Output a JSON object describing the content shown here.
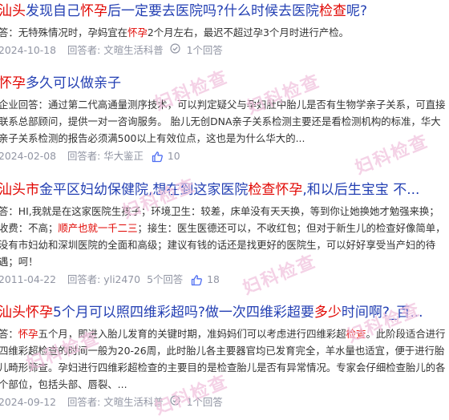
{
  "results": [
    {
      "title_parts": [
        {
          "text": "汕头",
          "hl": true
        },
        {
          "text": "发现自己",
          "hl": false
        },
        {
          "text": "怀孕",
          "hl": true
        },
        {
          "text": "后一定要去医院吗?什么时候去医院",
          "hl": false
        },
        {
          "text": "检查",
          "hl": true
        },
        {
          "text": "呢?",
          "hl": false
        }
      ],
      "snippet_parts": [
        {
          "text": "答：无特殊情况时，孕妈宜在",
          "hl": false
        },
        {
          "text": "怀孕",
          "hl": true
        },
        {
          "text": "2个月左右，最迟不超过孕3个月时进行产检。",
          "hl": false
        }
      ],
      "date": "2024-10-18",
      "answerer": "回答者: 文暄生活科普",
      "check_icon": true,
      "answers_count": "1个回答",
      "likes": ""
    },
    {
      "title_parts": [
        {
          "text": "怀孕",
          "hl": true
        },
        {
          "text": "多久可以做亲子",
          "hl": false
        }
      ],
      "snippet_parts": [
        {
          "text": "企业回答：通过第二代高通量测序技术，可以判定疑父与孕妇肚中胎儿是否有生物学亲子关系，可直接联系总部顾问，提供一对一咨询服务。 胎儿无创DNA亲子关系检测主要还是看检测机构的标准，华大亲子关系检测的报告必须满500以上有效位点，这也是为什么华大的...",
          "hl": false
        }
      ],
      "date": "2024-02-08",
      "answerer": "回答者: 华大鉴正",
      "check_icon": false,
      "answers_count": "",
      "likes": "10"
    },
    {
      "title_parts": [
        {
          "text": "汕头市",
          "hl": true
        },
        {
          "text": "金平区妇幼保健院,想在到这家医院",
          "hl": false
        },
        {
          "text": "检查怀孕",
          "hl": true
        },
        {
          "text": ",和以后生宝宝 不...",
          "hl": false
        }
      ],
      "snippet_parts": [
        {
          "text": "答：HI,我就是在这家医院生孩子；环境卫生：较差，床单没有天天换，等到你让她换她才勉强来换；收费：不高；",
          "hl": false
        },
        {
          "text": "顺产也就一千二三",
          "hl": true
        },
        {
          "text": "；接生：医生医德还可以，不收红包；但对于新生儿的检查好像简单，没有市妇幼和深圳医院的全面和高级；建议有钱的话还是找更好的医院生，可以好好享受当产妇的待遇；呵！",
          "hl": false
        }
      ],
      "date": "2011-04-22",
      "answerer": "回答者: yli2470",
      "check_icon": false,
      "answers_count": "5个回答",
      "likes": "18"
    },
    {
      "title_parts": [
        {
          "text": "汕头怀孕",
          "hl": true
        },
        {
          "text": "5个月可以照四维彩超吗?做一次四维彩超要",
          "hl": false
        },
        {
          "text": "多少",
          "hl": true
        },
        {
          "text": "时间啊?_百...",
          "hl": false
        }
      ],
      "snippet_parts": [
        {
          "text": "答：",
          "hl": false
        },
        {
          "text": "怀孕",
          "hl": true
        },
        {
          "text": "五个月，即进入胎儿发育的关键时期，准妈妈们可以考虑进行四维彩超",
          "hl": false
        },
        {
          "text": "检查",
          "hl": true
        },
        {
          "text": "。此阶段适合进行四维彩超检查的时间一般为20-26周，此时胎儿各主要器官均已发育完全，羊水量也适宜，便于进行胎儿畸形筛查。孕妇进行四维彩超检查的主要目的是检查胎儿是否有异常情况。专家会仔细检查胎儿的各个部位，包括头部、唇裂、...",
          "hl": false
        }
      ],
      "date": "2024-09-12",
      "answerer": "回答者: 文暄生活科普",
      "check_icon": true,
      "answers_count": "1个回答",
      "likes": ""
    }
  ],
  "watermark_text": "妇科检查",
  "colors": {
    "title": "#2440b3",
    "highlight": "#e10602",
    "meta": "#9195a3",
    "text": "#333333",
    "watermark": "#f1c3de"
  }
}
